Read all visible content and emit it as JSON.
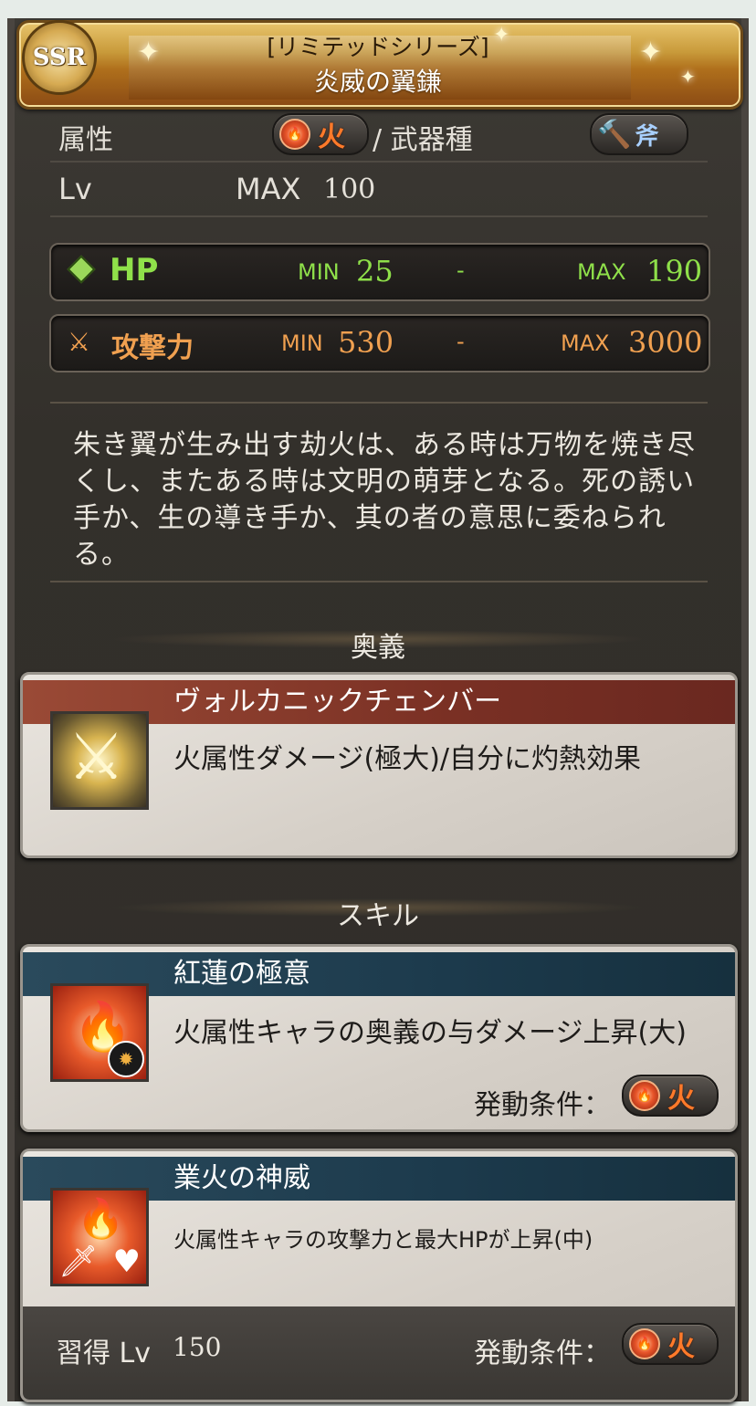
{
  "header": {
    "rarity": "SSR",
    "series": "[リミテッドシリーズ]",
    "weapon_name": "炎威の翼鎌"
  },
  "attributes": {
    "element_label": "属性",
    "element_value": "火",
    "weapon_type_label": "/ 武器種",
    "weapon_type_value": "斧"
  },
  "level": {
    "label": "Lv",
    "max_prefix": "MAX",
    "max_value": "100"
  },
  "stats": {
    "hp": {
      "label": "HP",
      "min_label": "MIN",
      "min": "25",
      "sep": "-",
      "max_label": "MAX",
      "max": "190"
    },
    "atk": {
      "label": "攻撃力",
      "min_label": "MIN",
      "min": "530",
      "sep": "-",
      "max_label": "MAX",
      "max": "3000"
    }
  },
  "description": "朱き翼が生み出す劫火は、ある時は万物を焼き尽くし、またある時は文明の萌芽となる。死の誘い手か、生の導き手か、其の者の意思に委ねられる。",
  "ougi": {
    "section_title": "奥義",
    "name": "ヴォルカニックチェンバー",
    "effect": "火属性ダメージ(極大)/自分に灼熱効果"
  },
  "skills": {
    "section_title": "スキル",
    "items": [
      {
        "name": "紅蓮の極意",
        "effect": "火属性キャラの奥義の与ダメージ上昇(大)",
        "condition_label": "発動条件：",
        "condition_value": "火"
      },
      {
        "name": "業火の神威",
        "effect": "火属性キャラの攻撃力と最大HPが上昇(中)",
        "learn_label": "習得 Lv",
        "learn_level": "150",
        "condition_label": "発動条件：",
        "condition_value": "火"
      }
    ]
  },
  "colors": {
    "hp_green": "#8fe04a",
    "atk_orange": "#f0a050",
    "fire_red": "#ff7a2a",
    "skill_header": "#1c3a4c",
    "ougi_header": "#7a3024"
  }
}
